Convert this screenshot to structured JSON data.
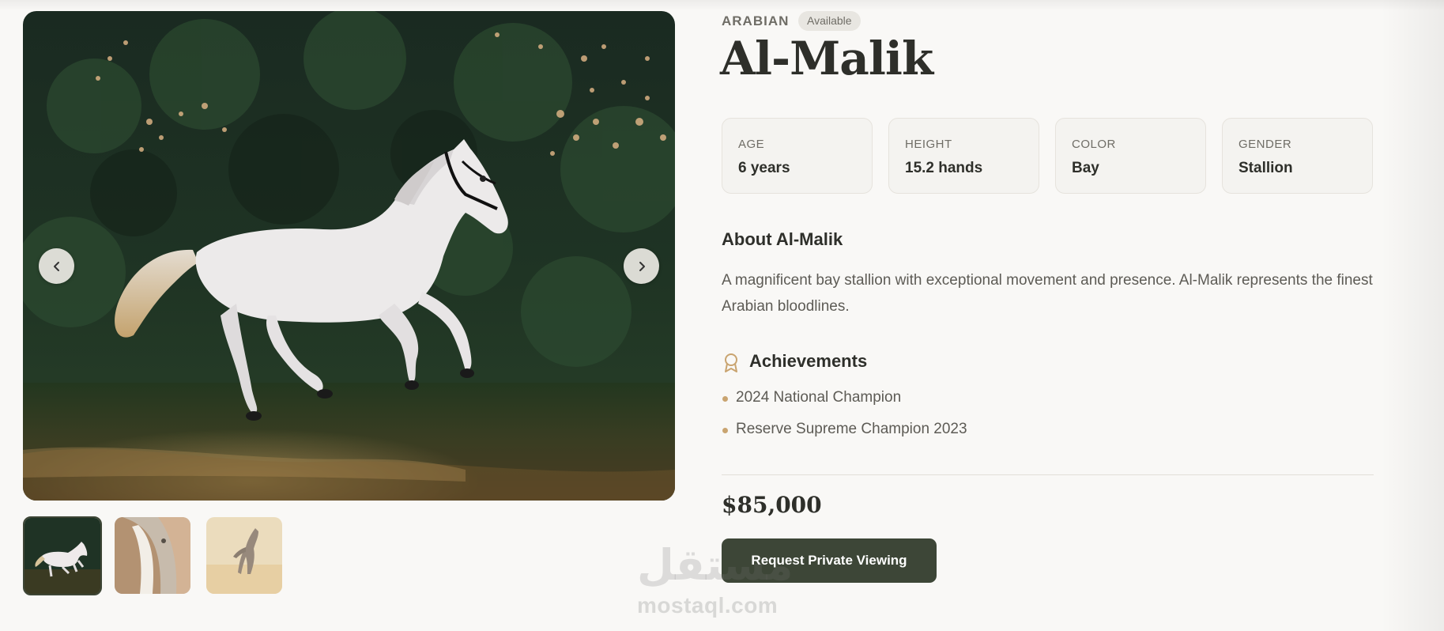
{
  "listing": {
    "breed": "ARABIAN",
    "status": "Available",
    "name": "Al-Malik",
    "price": "$85,000",
    "cta_label": "Request Private Viewing"
  },
  "gallery": {
    "main_image": "white-arabian-horse-galloping-in-forest",
    "prev_icon": "chevron-left-icon",
    "next_icon": "chevron-right-icon",
    "thumbnails": [
      {
        "image": "white-horse-galloping",
        "active": true
      },
      {
        "image": "horse-face-closeup",
        "active": false
      },
      {
        "image": "horse-rearing-in-field",
        "active": false
      }
    ]
  },
  "stats": [
    {
      "label": "AGE",
      "value": "6 years"
    },
    {
      "label": "HEIGHT",
      "value": "15.2 hands"
    },
    {
      "label": "COLOR",
      "value": "Bay"
    },
    {
      "label": "GENDER",
      "value": "Stallion"
    }
  ],
  "about": {
    "heading": "About Al-Malik",
    "text": "A magnificent bay stallion with exceptional movement and presence. Al-Malik represents the finest Arabian bloodlines."
  },
  "achievements": {
    "icon": "award-ribbon-icon",
    "heading": "Achievements",
    "items": [
      "2024 National Champion",
      "Reserve Supreme Champion 2023"
    ]
  },
  "watermark": {
    "arabic": "مستقل",
    "latin": "mostaql.com"
  },
  "colors": {
    "background": "#f9f8f6",
    "primary_button": "#3d4637",
    "accent": "#c9a470",
    "badge_bg": "#e8e6e1"
  }
}
